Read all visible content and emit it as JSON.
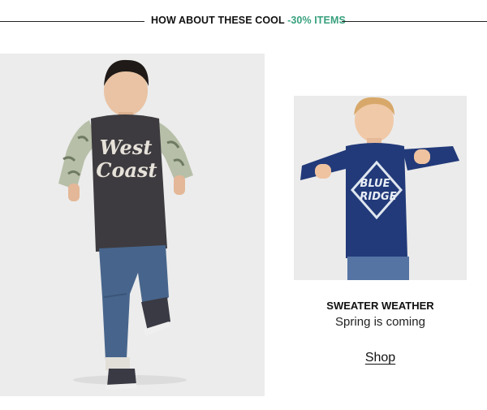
{
  "header": {
    "title_prefix": "HOW ABOUT THESE COOL ",
    "title_accent": "-30% ITEMS",
    "accent_color": "#38a17e"
  },
  "hero": {
    "shirt_text_line1": "West",
    "shirt_text_line2": "Coast"
  },
  "tile": {
    "shirt_text_line1": "BLUE",
    "shirt_text_line2": "RIDGE",
    "title": "SWEATER WEATHER",
    "subtitle": "Spring is coming",
    "cta": "Shop"
  }
}
